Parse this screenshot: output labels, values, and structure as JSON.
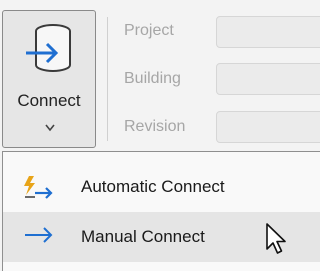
{
  "ribbon": {
    "connect_button": {
      "label": "Connect",
      "icon": "cylinder-arrow-icon",
      "chevron": "chevron-down-icon"
    },
    "fields": [
      {
        "label": "Project",
        "value": ""
      },
      {
        "label": "Building",
        "value": ""
      },
      {
        "label": "Revision",
        "value": ""
      }
    ]
  },
  "menu": {
    "items": [
      {
        "label": "Automatic Connect",
        "icon": "automatic-connect-icon"
      },
      {
        "label": "Manual Connect",
        "icon": "arrow-right-icon",
        "hovered": true
      }
    ]
  },
  "colors": {
    "accent": "#1f6fd1",
    "automatic_icon": "#e8a418",
    "hover_bg": "#e5e5e5"
  }
}
